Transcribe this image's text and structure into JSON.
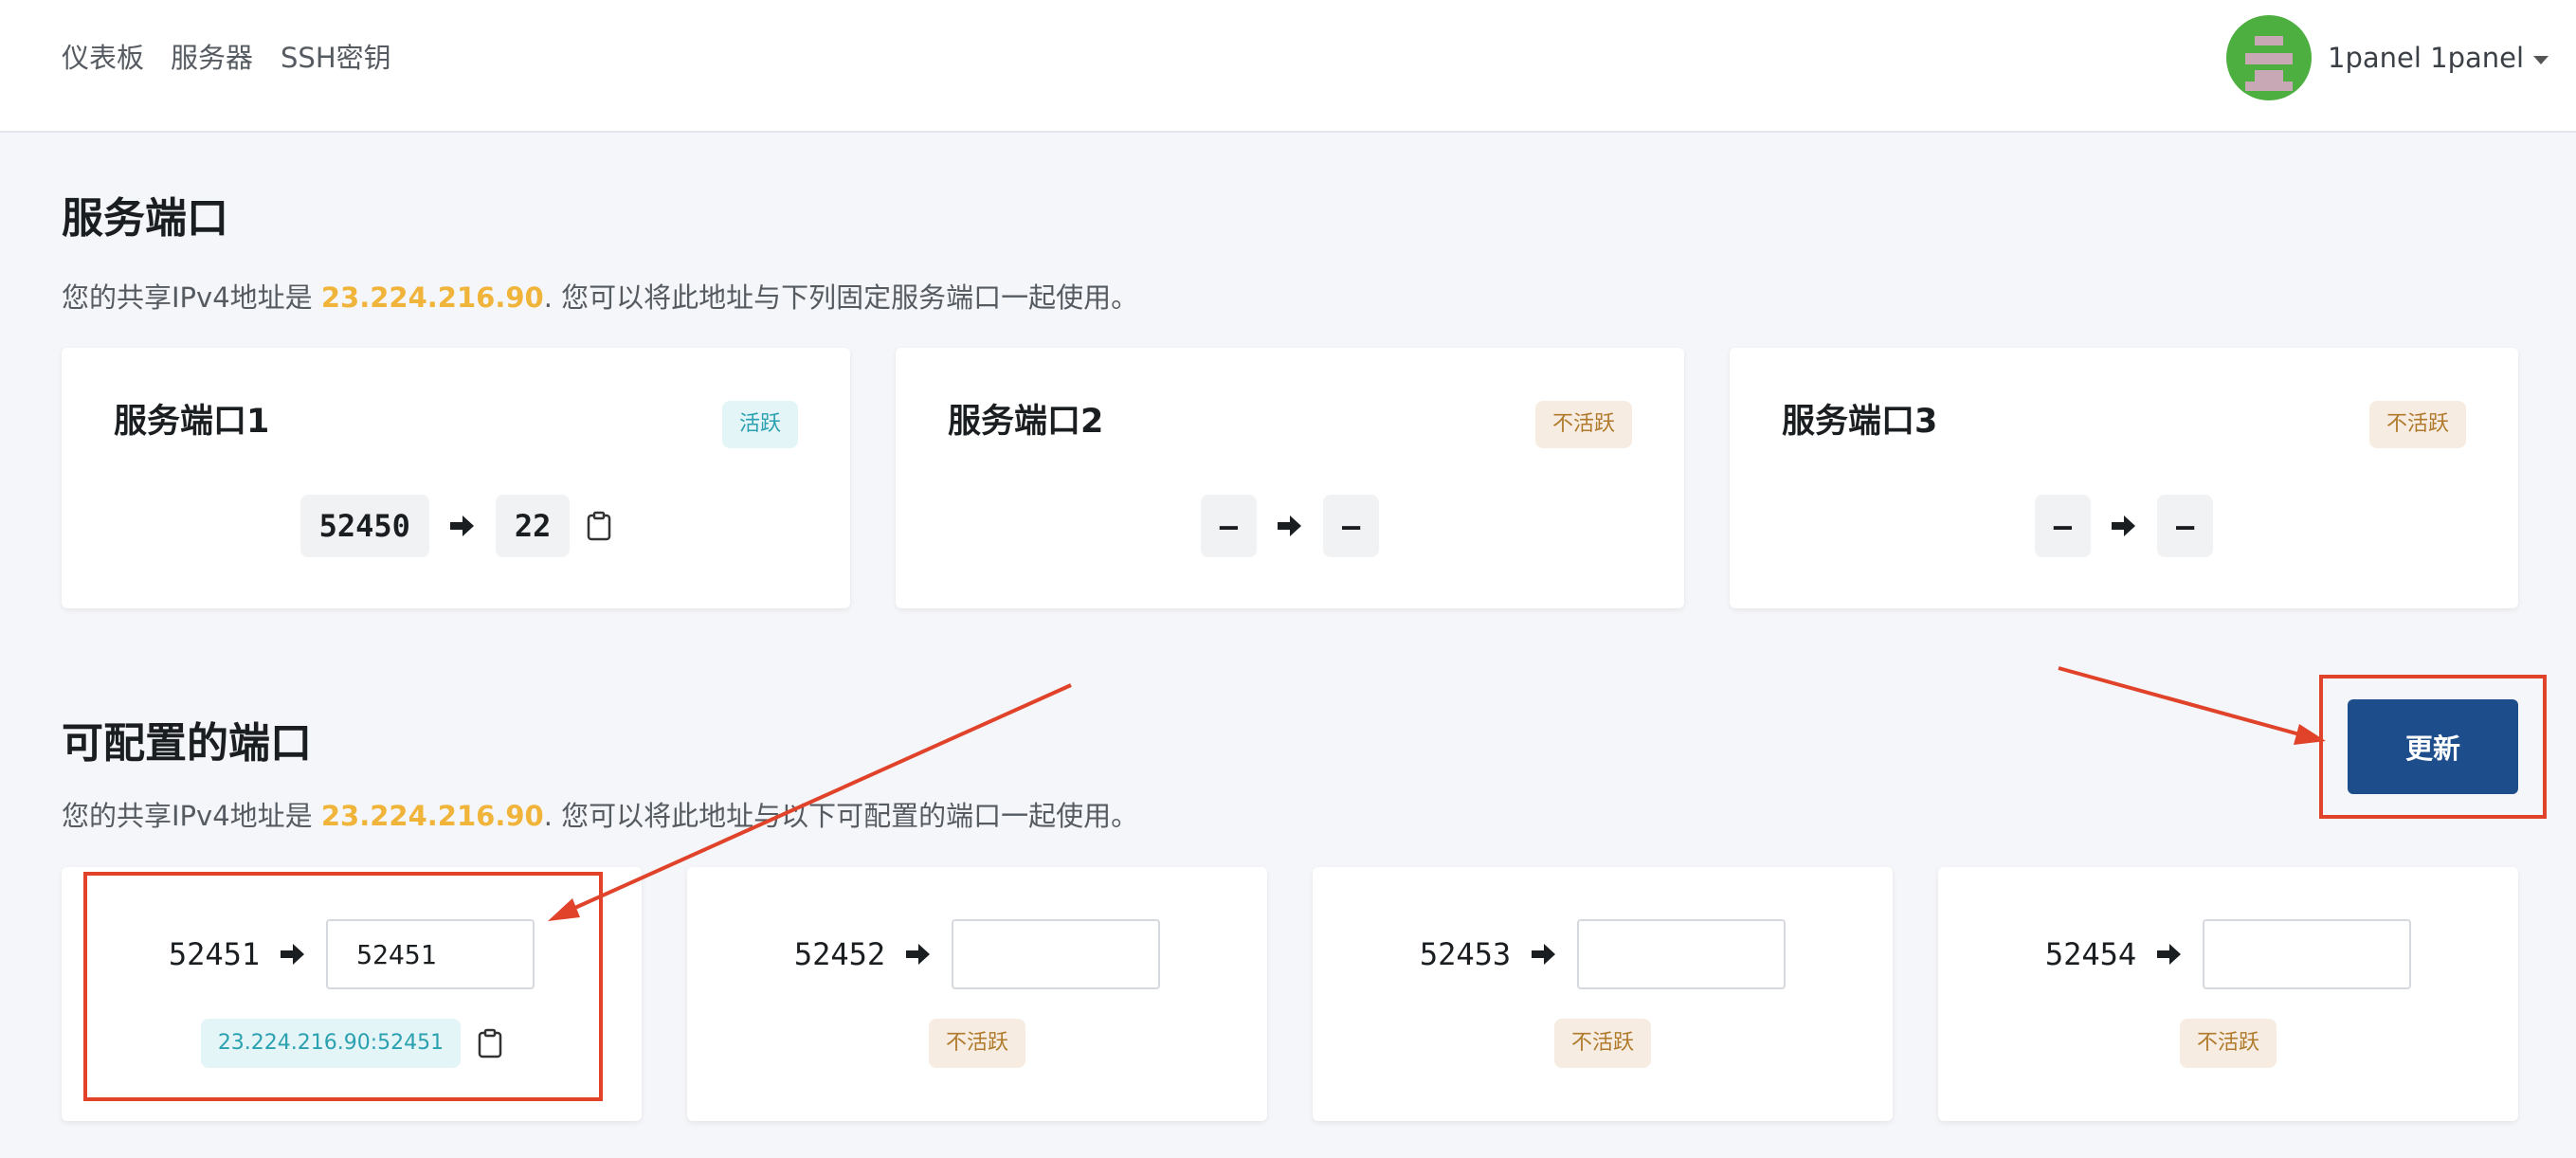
{
  "nav": {
    "items": [
      "仪表板",
      "服务器",
      "SSH密钥"
    ],
    "user": "1panel 1panel"
  },
  "service_ports": {
    "title": "服务端口",
    "desc_prefix": "您的共享IPv4地址是 ",
    "ip": "23.224.216.90",
    "desc_suffix": ". 您可以将此地址与下列固定服务端口一起使用。",
    "cards": [
      {
        "title": "服务端口1",
        "status": "活跃",
        "from": "52450",
        "to": "22"
      },
      {
        "title": "服务端口2",
        "status": "不活跃",
        "from": "–",
        "to": "–"
      },
      {
        "title": "服务端口3",
        "status": "不活跃",
        "from": "–",
        "to": "–"
      }
    ]
  },
  "configurable_ports": {
    "title": "可配置的端口",
    "desc_prefix": "您的共享IPv4地址是 ",
    "ip": "23.224.216.90",
    "desc_suffix": ". 您可以将此地址与以下可配置的端口一起使用。",
    "update_label": "更新",
    "items": [
      {
        "port": "52451",
        "value": "52451",
        "status": "23.224.216.90:52451"
      },
      {
        "port": "52452",
        "value": "",
        "status": "不活跃"
      },
      {
        "port": "52453",
        "value": "",
        "status": "不活跃"
      },
      {
        "port": "52454",
        "value": "",
        "status": "不活跃"
      }
    ]
  },
  "colors": {
    "accent": "#1e4d8c",
    "ip_highlight": "#f0b43a",
    "annotation": "#e0432a"
  },
  "icons": [
    "arrow-right-icon",
    "clipboard-icon",
    "caret-down-icon"
  ]
}
